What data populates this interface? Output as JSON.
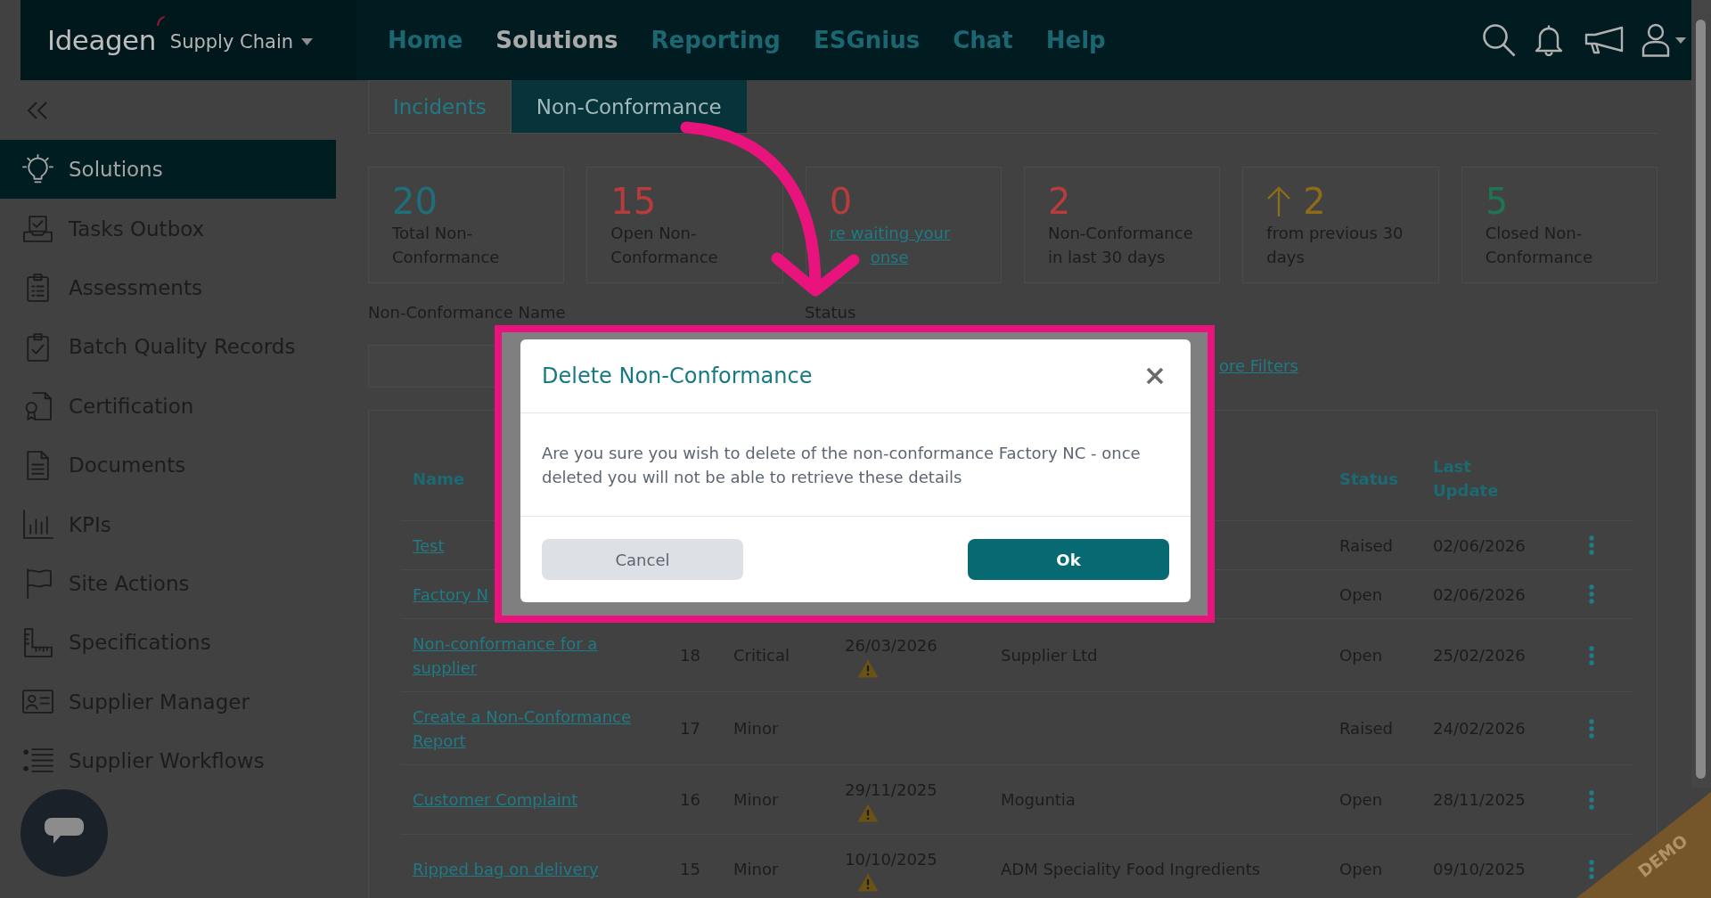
{
  "app_bar": {
    "logo": "Ideagen",
    "product": "Supply Chain",
    "nav": [
      {
        "label": "Home",
        "selected": false
      },
      {
        "label": "Solutions",
        "selected": true
      },
      {
        "label": "Reporting",
        "selected": false
      },
      {
        "label": "ESGnius",
        "selected": false
      },
      {
        "label": "Chat",
        "selected": false
      },
      {
        "label": "Help",
        "selected": false
      }
    ]
  },
  "sidebar": {
    "items": [
      {
        "label": "Solutions",
        "selected": true
      },
      {
        "label": "Tasks Outbox",
        "selected": false
      },
      {
        "label": "Assessments",
        "selected": false
      },
      {
        "label": "Batch Quality Records",
        "selected": false
      },
      {
        "label": "Certification",
        "selected": false
      },
      {
        "label": "Documents",
        "selected": false
      },
      {
        "label": "KPIs",
        "selected": false
      },
      {
        "label": "Site Actions",
        "selected": false
      },
      {
        "label": "Specifications",
        "selected": false
      },
      {
        "label": "Supplier Manager",
        "selected": false
      },
      {
        "label": "Supplier Workflows",
        "selected": false
      }
    ]
  },
  "tabs": [
    {
      "label": "Incidents",
      "selected": false
    },
    {
      "label": "Non-Conformance",
      "selected": true
    }
  ],
  "stats": [
    {
      "kind": "count",
      "value": "20",
      "label": "Total Non-Conformance",
      "color": "#1f6f7a"
    },
    {
      "kind": "count",
      "value": "15",
      "label": "Open Non-Conformance",
      "color": "#b83c3c"
    },
    {
      "kind": "link",
      "value": "0",
      "label_lines": [
        "re waiting your",
        "onse"
      ],
      "color": "#b83c3c"
    },
    {
      "kind": "count",
      "value": "2",
      "label": "Non-Conformance in last 30 days",
      "color": "#b83c3c"
    },
    {
      "kind": "trend",
      "value": "2",
      "label": "from previous 30 days",
      "color": "#8c6c1a"
    },
    {
      "kind": "count",
      "value": "5",
      "label": "Closed Non-Conformance",
      "color": "#1f7553"
    }
  ],
  "filters": {
    "name_label": "Non-Conformance Name",
    "status_label": "Status",
    "link": "ore Filters"
  },
  "table": {
    "headings": {
      "name": "Name",
      "status": "Status",
      "last_update": "Last Update"
    },
    "rows": [
      {
        "name": "Test",
        "status": "Raised",
        "last_update": "02/06/2026"
      },
      {
        "name": "Factory N",
        "status": "Open",
        "last_update": "02/06/2026"
      },
      {
        "name": "Non-conformance for a supplier",
        "column_2": "18",
        "column_3": "Critical",
        "column_4": "26/03/2026",
        "warning": true,
        "column_5": "Supplier Ltd",
        "status": "Open",
        "last_update": "25/02/2026"
      },
      {
        "name": "Create a Non-Conformance Report",
        "column_2": "17",
        "column_3": "Minor",
        "warning": false,
        "status": "Raised",
        "last_update": "24/02/2026"
      },
      {
        "name": "Customer Complaint",
        "column_2": "16",
        "column_3": "Minor",
        "column_4": "29/11/2025",
        "warning": true,
        "column_5": "Moguntia",
        "status": "Open",
        "last_update": "28/11/2025"
      },
      {
        "name": "Ripped bag on delivery",
        "column_2": "15",
        "column_3": "Minor",
        "column_4": "10/10/2025",
        "warning": true,
        "column_5": "ADM Speciality Food Ingredients",
        "status": "Open",
        "last_update": "09/10/2025"
      }
    ]
  },
  "dialog": {
    "title": "Delete Non-Conformance",
    "message": "Are you sure you wish to delete of the non-conformance Factory NC - once deleted you will not be able to retrieve these details",
    "buttons": [
      {
        "kind": "cancel",
        "label": "Cancel"
      },
      {
        "kind": "confirm",
        "label": "Ok"
      }
    ]
  },
  "ribbon": {
    "label": "DEMO"
  }
}
